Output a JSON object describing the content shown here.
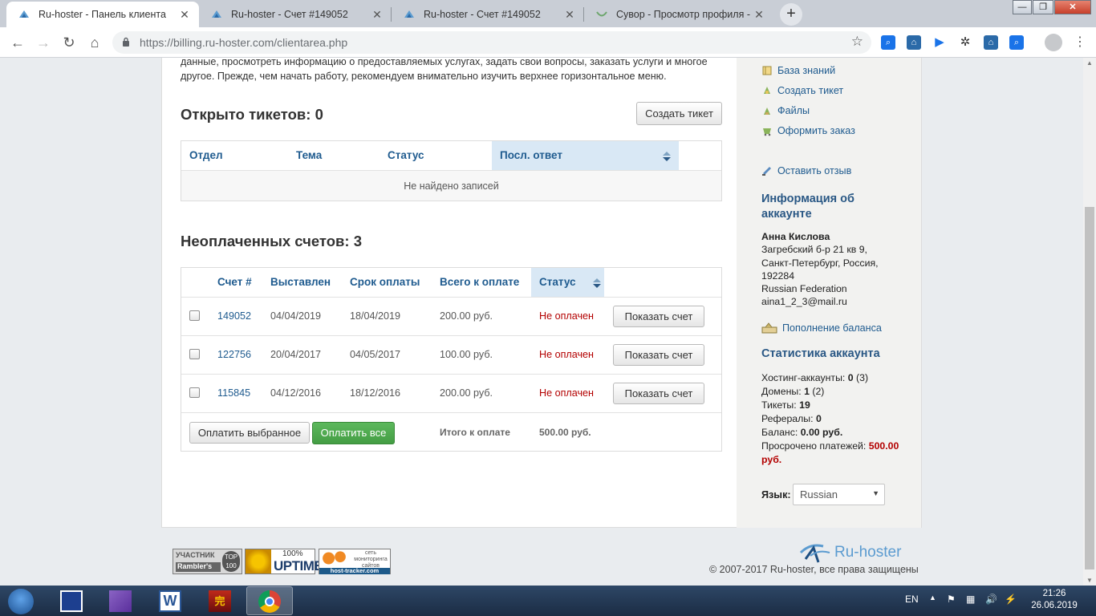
{
  "browser": {
    "tabs": [
      {
        "title": "Ru-hoster - Панель клиента",
        "active": true
      },
      {
        "title": "Ru-hoster - Счет #149052",
        "active": false
      },
      {
        "title": "Ru-hoster - Счет #149052",
        "active": false
      },
      {
        "title": "Сувор - Просмотр профиля - Ti",
        "active": false
      }
    ],
    "new_tab_label": "+",
    "url_host": "https://billing.ru-hoster.com",
    "url_path": "/clientarea.php"
  },
  "intro_text": "данные, просмотреть информацию о предоставляемых услугах, задать свои вопросы, заказать услуги и многое другое. Прежде, чем начать работу, рекомендуем внимательно изучить верхнее горизонтальное меню.",
  "tickets": {
    "heading": "Открыто тикетов: 0",
    "create_button": "Создать тикет",
    "columns": [
      "Отдел",
      "Тема",
      "Статус",
      "Посл. ответ"
    ],
    "empty_message": "Не найдено записей"
  },
  "invoices": {
    "heading": "Неоплаченных счетов: 3",
    "columns": [
      "Счет #",
      "Выставлен",
      "Срок оплаты",
      "Всего к оплате",
      "Статус"
    ],
    "rows": [
      {
        "id": "149052",
        "issued": "04/04/2019",
        "due": "18/04/2019",
        "total": "200.00 руб.",
        "status": "Не оплачен",
        "action": "Показать счет"
      },
      {
        "id": "122756",
        "issued": "20/04/2017",
        "due": "04/05/2017",
        "total": "100.00 руб.",
        "status": "Не оплачен",
        "action": "Показать счет"
      },
      {
        "id": "115845",
        "issued": "04/12/2016",
        "due": "18/12/2016",
        "total": "200.00 руб.",
        "status": "Не оплачен",
        "action": "Показать счет"
      }
    ],
    "pay_selected": "Оплатить выбранное",
    "pay_all": "Оплатить все",
    "total_label": "Итого к оплате",
    "total_value": "500.00 руб."
  },
  "sidebar": {
    "links": [
      "База знаний",
      "Создать тикет",
      "Файлы",
      "Оформить заказ"
    ],
    "feedback": "Оставить отзыв",
    "account_heading_1": "Информация об",
    "account_heading_2": "аккаунте",
    "name": "Анна Кислова",
    "address_1": "Загребский б-р 21 кв 9,",
    "address_2": "Санкт-Петербург, Россия,",
    "zip": "192284",
    "country": "Russian Federation",
    "email": "aina1_2_3@mail.ru",
    "topup": "Пополнение баланса",
    "stats_heading": "Статистика аккаунта",
    "stats": {
      "hosting_label": "Хостинг-аккаунты:",
      "hosting_value": "0",
      "hosting_extra": "(3)",
      "domains_label": "Домены:",
      "domains_value": "1",
      "domains_extra": "(2)",
      "tickets_label": "Тикеты:",
      "tickets_value": "19",
      "referrals_label": "Рефералы:",
      "referrals_value": "0",
      "balance_label": "Баланс:",
      "balance_value": "0.00 руб.",
      "overdue_label": "Просрочено платежей:",
      "overdue_value_1": "500.00",
      "overdue_value_2": "руб."
    },
    "language_label": "Язык:",
    "language_value": "Russian"
  },
  "footer": {
    "badges": {
      "rambler_1": "УЧАСТНИК",
      "rambler_2": "Rambler's",
      "rambler_3": "TOP",
      "rambler_4": "100",
      "uptime_pct": "100%",
      "uptime_word": "UPTIME",
      "tracker_1": "сеть",
      "tracker_2": "мониторинга",
      "tracker_3": "сайтов",
      "tracker_4": "host-tracker.com"
    },
    "logo_text": "Ru-hoster",
    "copyright": "© 2007-2017 Ru-hoster, все права защищены"
  },
  "taskbar": {
    "lang": "EN",
    "time": "21:26",
    "date": "26.06.2019"
  }
}
